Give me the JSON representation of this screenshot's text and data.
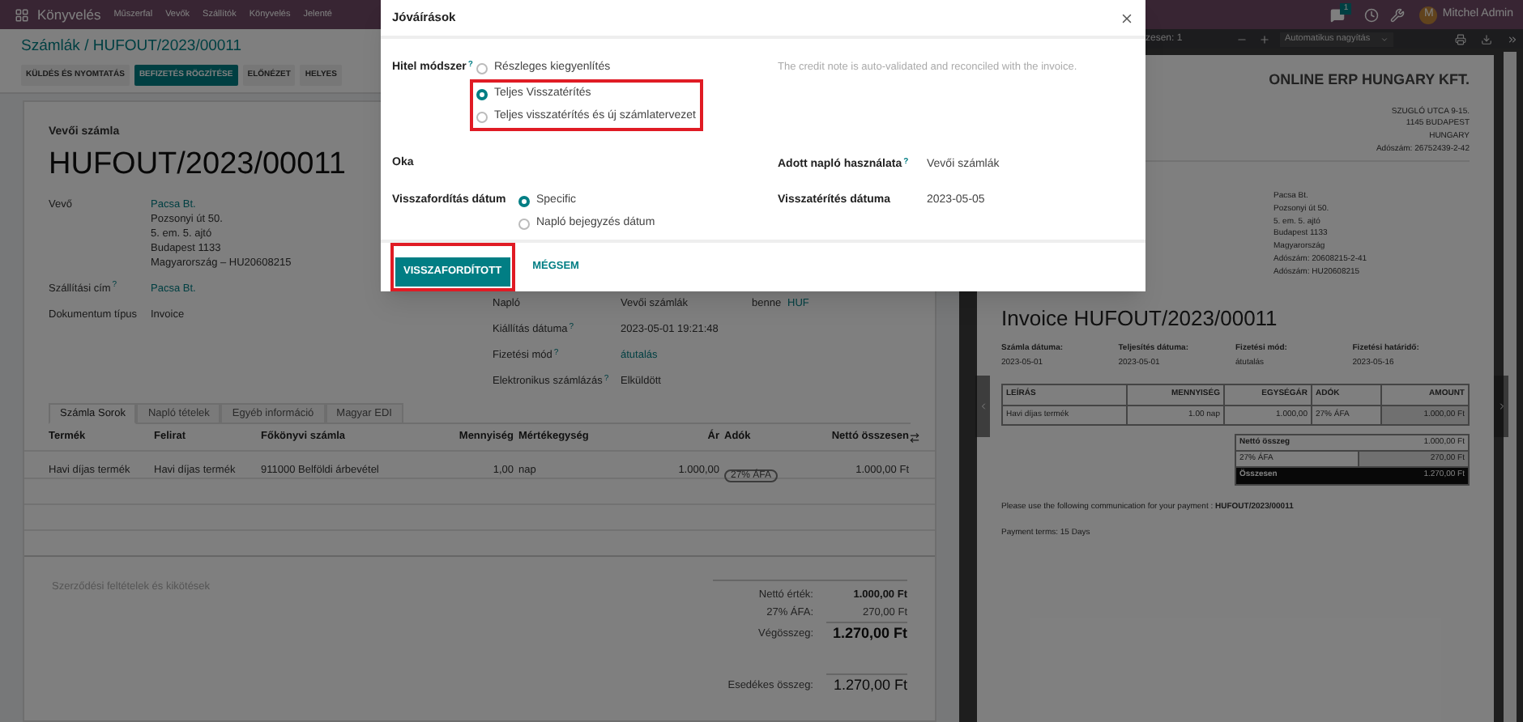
{
  "navbar": {
    "app_name": "Könyvelés",
    "menu": [
      "Műszerfal",
      "Vevők",
      "Szállítók",
      "Könyvelés",
      "Jelenté"
    ],
    "chat_badge": "1",
    "avatar_letter": "M",
    "user": "Mitchel Admin"
  },
  "breadcrumb": "Számlák / HUFOUT/2023/00011",
  "actions": [
    {
      "label": "KÜLDÉS ÉS NYOMTATÁS",
      "primary": false
    },
    {
      "label": "BEFIZETÉS RÖGZÍTÉSE",
      "primary": true
    },
    {
      "label": "ELŐNÉZET",
      "primary": false
    },
    {
      "label": "HELYES",
      "primary": false
    }
  ],
  "form": {
    "doc_type": "Vevői számla",
    "number": "HUFOUT/2023/00011",
    "left_fields": [
      {
        "label": "Vevő",
        "lines": [
          "Pacsa Bt.",
          "Pozsonyi út 50.",
          "5. em. 5. ajtó",
          "Budapest 1133",
          "Magyarország – HU20608215"
        ],
        "link": true
      },
      {
        "label": "Szállítási cím",
        "help_mark": "?",
        "lines": [
          "Pacsa Bt."
        ],
        "link": true
      },
      {
        "label": "Dokumentum típus",
        "lines": [
          "Invoice"
        ],
        "link": false
      }
    ],
    "right_fields": [
      {
        "label": "Napló",
        "value": "Vevői számlák",
        "link": false,
        "extra_label": "benne",
        "extra_value": "HUF"
      },
      {
        "label": "Kiállítás dátuma",
        "help_mark": "?",
        "value": "2023-05-01 19:21:48",
        "link": false
      },
      {
        "label": "Fizetési mód",
        "help_mark": "?",
        "value": "átutalás",
        "link": true
      },
      {
        "label": "Elektronikus számlázás",
        "help_mark": "?",
        "value": "Elküldött",
        "link": false
      }
    ],
    "tabs": [
      {
        "label": "Számla Sorok",
        "selected": true
      },
      {
        "label": "Napló tételek",
        "selected": false
      },
      {
        "label": "Egyéb információ",
        "selected": false
      },
      {
        "label": "Magyar EDI",
        "selected": false
      }
    ],
    "table": {
      "columns": [
        "Termék",
        "Felirat",
        "Főkönyvi számla",
        "Mennyiség",
        "Mértékegység",
        "Ár",
        "Adók",
        "Nettó összesen"
      ],
      "rows": [
        {
          "cells": [
            {
              "text": "Havi díjas termék",
              "kind": "text"
            },
            {
              "text": "Havi díjas termék",
              "kind": "text"
            },
            {
              "text": "911000 Belföldi árbevétel",
              "kind": "text"
            },
            {
              "text": "1,00",
              "kind": "text"
            },
            {
              "text": "nap",
              "kind": "text"
            },
            {
              "text": "1.000,00",
              "kind": "text"
            },
            {
              "text": "27% ÁFA",
              "kind": "tag"
            },
            {
              "text": "1.000,00 Ft",
              "kind": "text"
            }
          ]
        }
      ]
    },
    "terms_placeholder": "Szerződési feltételek és kikötések",
    "totals": [
      {
        "label": "Nettó érték:",
        "value": "1.000,00 Ft",
        "kind": "subtotal"
      },
      {
        "label": "27% ÁFA:",
        "value": "270,00 Ft",
        "kind": "tax"
      },
      {
        "label": "Végösszeg:",
        "value": "1.270,00 Ft",
        "kind": "total"
      }
    ],
    "amount_due": {
      "label": "Esedékes összeg:",
      "value": "1.270,00 Ft"
    }
  },
  "viewer": {
    "page_info": "zesen: 1",
    "zoom": "Automatikus nagyítás"
  },
  "preview": {
    "company": "ONLINE ERP HUNGARY KFT.",
    "company_address": [
      "SZUGLÓ UTCA 9-15.",
      "1145 BUDAPEST",
      "HUNGARY",
      "Adószám: 26752439-2-42"
    ],
    "customer": [
      "Pacsa Bt.",
      "Pozsonyi út 50.",
      "5. em. 5. ajtó",
      "Budapest 1133",
      "Magyarország",
      "Adószám: 20608215-2-41",
      "Adószám: HU20608215"
    ],
    "title": "Invoice HUFOUT/2023/00011",
    "info": [
      {
        "label": "Számla dátuma:",
        "value": "2023-05-01"
      },
      {
        "label": "Teljesítés dátuma:",
        "value": "2023-05-01"
      },
      {
        "label": "Fizetési mód:",
        "value": "átutalás"
      },
      {
        "label": "Fizetési határidő:",
        "value": "2023-05-16"
      }
    ],
    "columns": [
      "LEÍRÁS",
      "MENNYISÉG",
      "EGYSÉGÁR",
      "ADÓK",
      "AMOUNT"
    ],
    "rows": [
      [
        "Havi díjas termék",
        "1.00 nap",
        "1.000,00",
        "27% ÁFA",
        "1.000,00 Ft"
      ]
    ],
    "totals": [
      {
        "label": "Nettó összeg",
        "value": "1.000,00 Ft",
        "kind": "subtotal"
      },
      {
        "label": "27% ÁFA",
        "value": "270,00 Ft",
        "kind": "tax"
      },
      {
        "label": "Összesen",
        "value": "1.270,00 Ft",
        "kind": "total"
      }
    ],
    "payment_note": "Please use the following communication for your payment : **HUFOUT/2023/00011**",
    "payment_terms": "Payment terms: 15 Days"
  },
  "modal": {
    "title": "Jóváírások",
    "method": {
      "label": "Hitel módszer",
      "help_mark": "?",
      "options": [
        {
          "label": "Részleges kiegyenlítés",
          "selected": false,
          "highlighted": false
        },
        {
          "label": "Teljes Visszatérítés",
          "selected": true,
          "highlighted": true
        },
        {
          "label": "Teljes visszatérítés és új számlatervezet",
          "selected": false,
          "highlighted": true
        }
      ],
      "hint": "The credit note is auto-validated and reconciled with the invoice."
    },
    "reason": {
      "label": "Oka"
    },
    "journal": {
      "label": "Adott napló használata",
      "help_mark": "?",
      "value": "Vevői számlák"
    },
    "reversal_date": {
      "label": "Visszafordítás dátum",
      "options": [
        {
          "label": "Specific",
          "selected": true,
          "highlighted": false
        },
        {
          "label": "Napló bejegyzés dátum",
          "selected": false,
          "highlighted": false
        }
      ]
    },
    "refund_date": {
      "label": "Visszatérítés dátuma",
      "value": "2023-05-05"
    },
    "buttons": [
      {
        "label": "VISSZAFORDÍTOTT",
        "primary": true,
        "highlighted": true
      },
      {
        "label": "MÉGSEM",
        "primary": false,
        "highlighted": false
      }
    ]
  }
}
